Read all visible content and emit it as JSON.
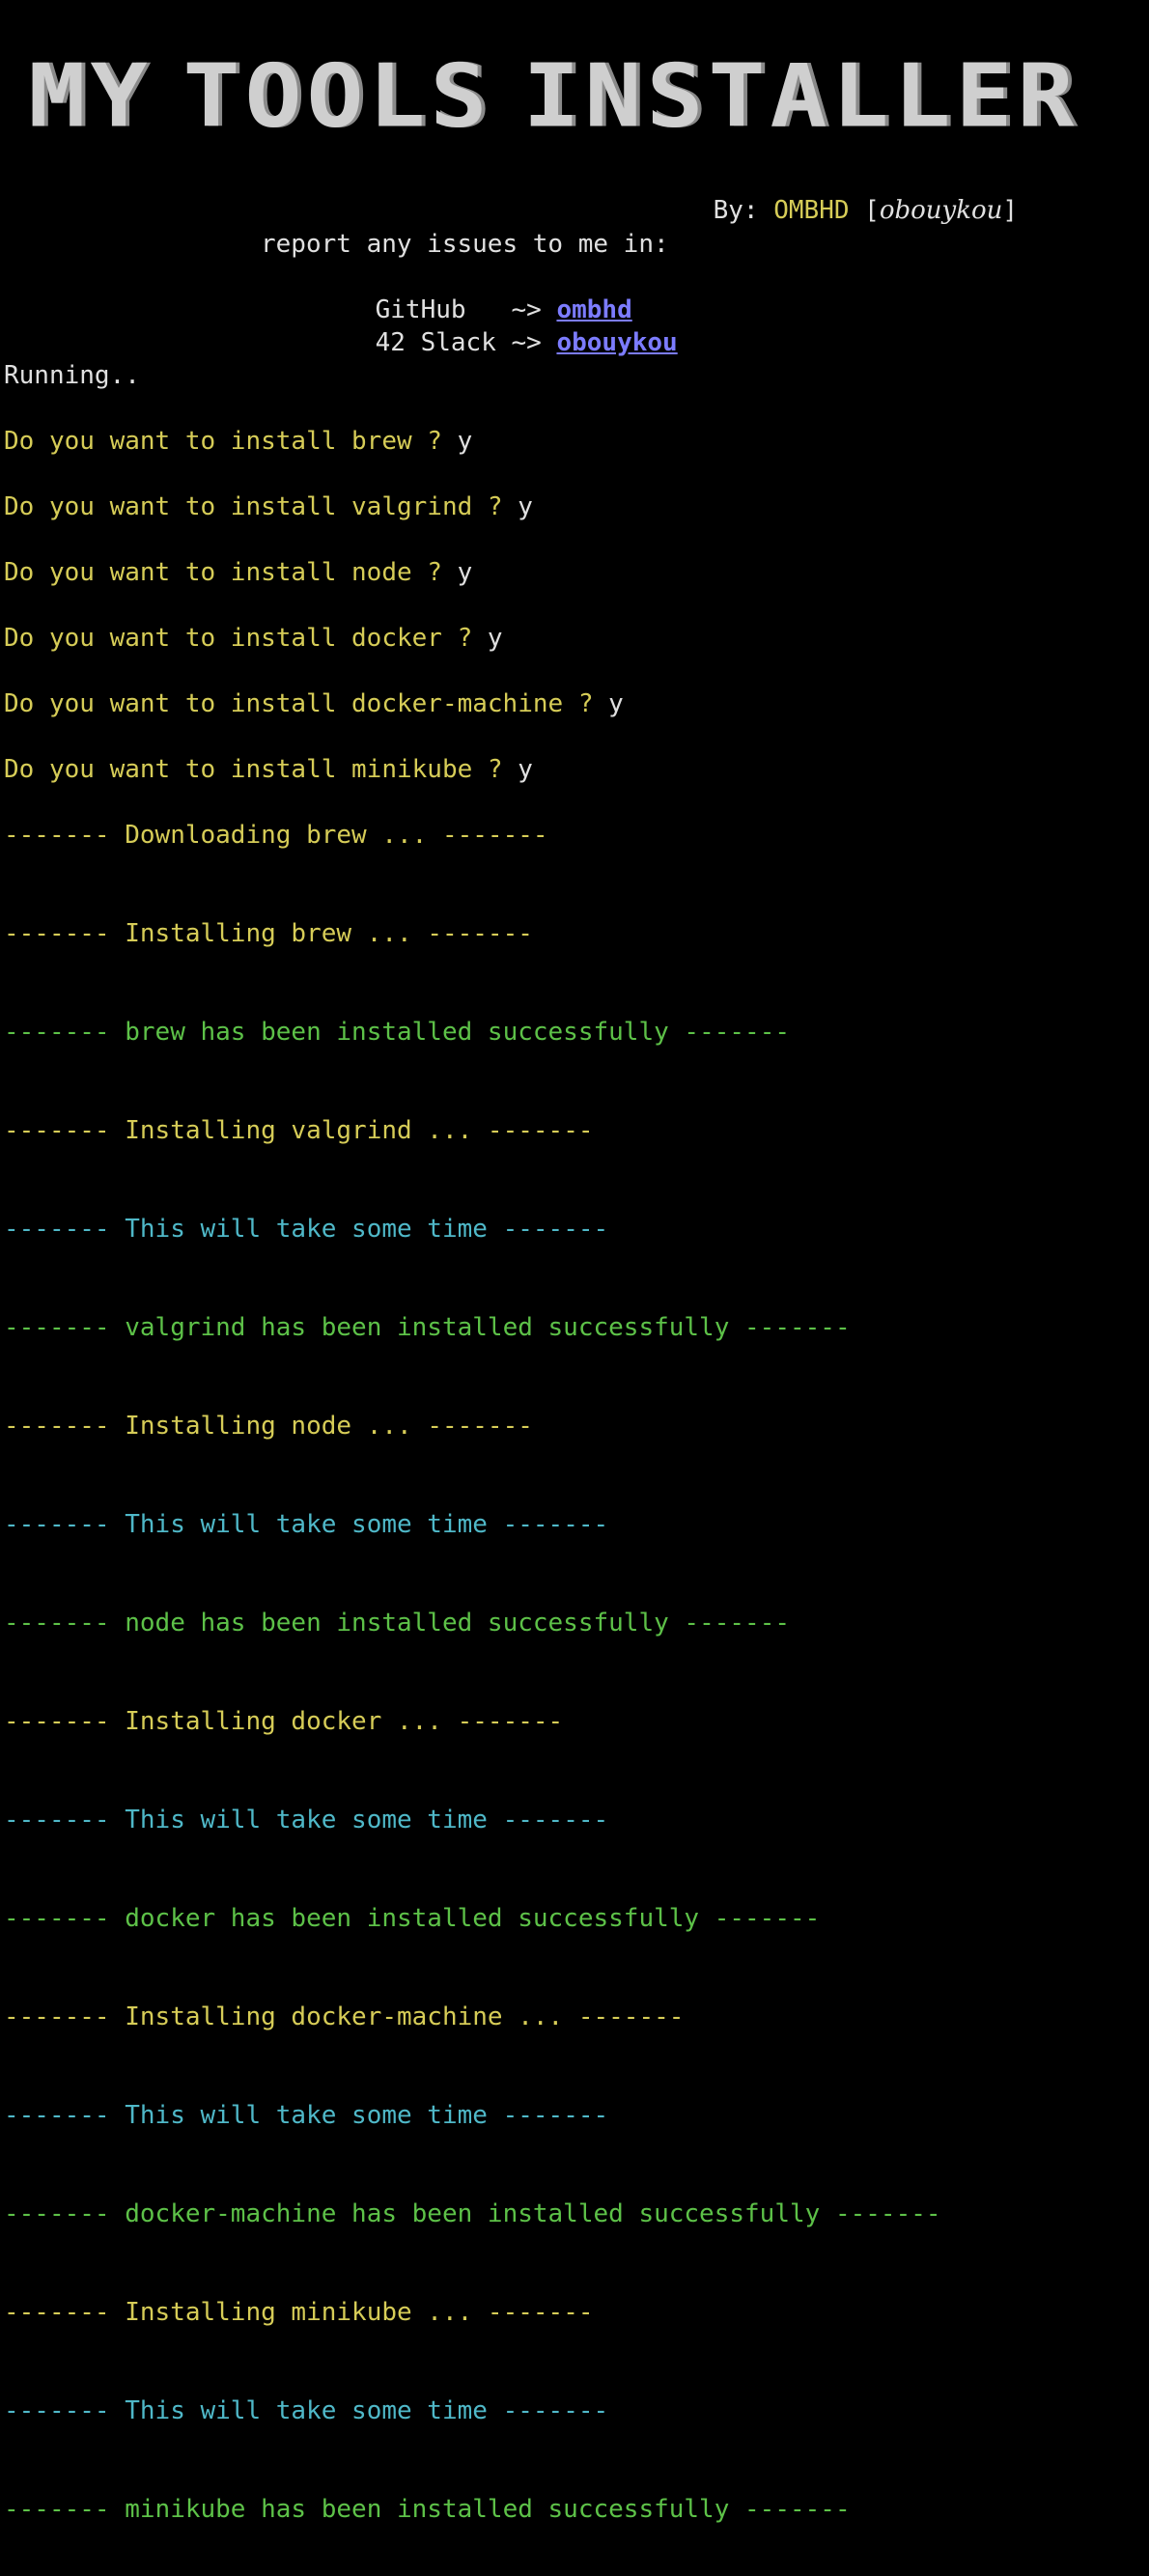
{
  "banner": {
    "chars": [
      "M",
      "Y",
      " ",
      "T",
      "O",
      "O",
      "L",
      "S",
      " ",
      "I",
      "N",
      "S",
      "T",
      "A",
      "L",
      "L",
      "E",
      "R"
    ]
  },
  "byline": {
    "prefix": "By: ",
    "name": "OMBHD",
    "open": " [",
    "handle": "obouykou",
    "close": "]"
  },
  "report": {
    "intro": "report any issues to me in:",
    "github_label": "GitHub   ~> ",
    "github_link": "ombhd",
    "slack_label": "42 Slack ~> ",
    "slack_link": "obouykou"
  },
  "status": "Running..",
  "prompts": [
    {
      "question": "Do you want to install brew ? ",
      "answer": "y"
    },
    {
      "question": "Do you want to install valgrind ? ",
      "answer": "y"
    },
    {
      "question": "Do you want to install node ? ",
      "answer": "y"
    },
    {
      "question": "Do you want to install docker ? ",
      "answer": "y"
    },
    {
      "question": "Do you want to install docker-machine ? ",
      "answer": "y"
    },
    {
      "question": "Do you want to install minikube ? ",
      "answer": "y"
    }
  ],
  "log": [
    {
      "dashes": "------- ",
      "text": "Downloading brew ... ",
      "tail": "-------",
      "color": "#d6cc57"
    },
    {
      "dashes": "------- ",
      "text": "Installing brew ... ",
      "tail": "-------",
      "color": "#d6cc57"
    },
    {
      "dashes": "------- ",
      "text": "brew has been installed successfully ",
      "tail": "-------",
      "color": "#5dc148"
    },
    {
      "dashes": "------- ",
      "text": "Installing valgrind ... ",
      "tail": "-------",
      "color": "#d6cc57"
    },
    {
      "dashes": "------- ",
      "text": "This will take some time ",
      "tail": "-------",
      "color": "#4fb8c8"
    },
    {
      "dashes": "------- ",
      "text": "valgrind has been installed successfully ",
      "tail": "-------",
      "color": "#5dc148"
    },
    {
      "dashes": "------- ",
      "text": "Installing node ... ",
      "tail": "-------",
      "color": "#d6cc57"
    },
    {
      "dashes": "------- ",
      "text": "This will take some time ",
      "tail": "-------",
      "color": "#4fb8c8"
    },
    {
      "dashes": "------- ",
      "text": "node has been installed successfully ",
      "tail": "-------",
      "color": "#5dc148"
    },
    {
      "dashes": "------- ",
      "text": "Installing docker ... ",
      "tail": "-------",
      "color": "#d6cc57"
    },
    {
      "dashes": "------- ",
      "text": "This will take some time ",
      "tail": "-------",
      "color": "#4fb8c8"
    },
    {
      "dashes": "------- ",
      "text": "docker has been installed successfully ",
      "tail": "-------",
      "color": "#5dc148"
    },
    {
      "dashes": "------- ",
      "text": "Installing docker-machine ... ",
      "tail": "-------",
      "color": "#d6cc57"
    },
    {
      "dashes": "------- ",
      "text": "This will take some time ",
      "tail": "-------",
      "color": "#4fb8c8"
    },
    {
      "dashes": "------- ",
      "text": "docker-machine has been installed successfully ",
      "tail": "-------",
      "color": "#5dc148"
    },
    {
      "dashes": "------- ",
      "text": "Installing minikube ... ",
      "tail": "-------",
      "color": "#d6cc57"
    },
    {
      "dashes": "------- ",
      "text": "This will take some time ",
      "tail": "-------",
      "color": "#4fb8c8"
    },
    {
      "dashes": "------- ",
      "text": "minikube has been installed successfully ",
      "tail": "-------",
      "color": "#5dc148"
    }
  ],
  "colors": {
    "background": "#000000",
    "prompt": "#d6cc57",
    "success": "#5dc148",
    "info": "#4fb8c8",
    "link": "#7c7cff"
  }
}
